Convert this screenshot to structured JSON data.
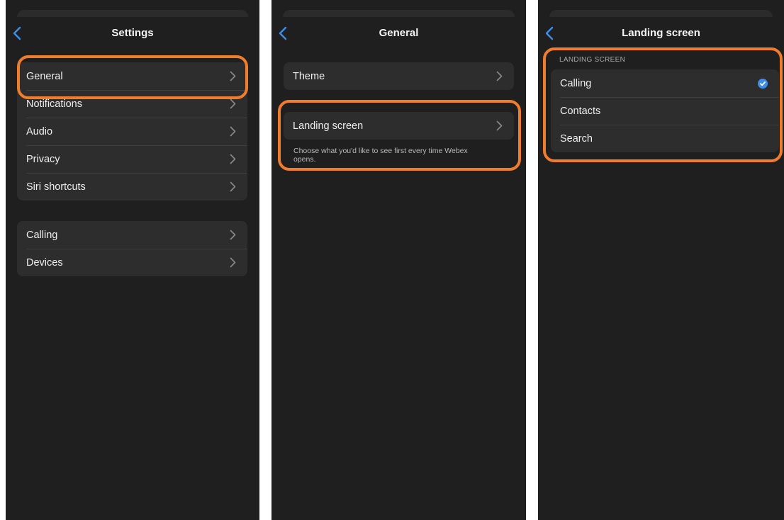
{
  "screens": [
    {
      "title": "Settings",
      "groups": [
        {
          "items": [
            "General",
            "Notifications",
            "Audio",
            "Privacy",
            "Siri shortcuts"
          ]
        },
        {
          "items": [
            "Calling",
            "Devices"
          ]
        }
      ]
    },
    {
      "title": "General",
      "theme_label": "Theme",
      "landing_label": "Landing screen",
      "landing_note": "Choose what you'd like to see first every time Webex opens."
    },
    {
      "title": "Landing screen",
      "section_header": "LANDING SCREEN",
      "options": [
        "Calling",
        "Contacts",
        "Search"
      ],
      "selected": "Calling"
    }
  ],
  "colors": {
    "highlight": "#ef7d2d",
    "accent": "#3d8eea",
    "background": "#1f1f1f",
    "cell": "#2d2d2d"
  },
  "icons": [
    "back-chevron-icon",
    "chevron-right-icon",
    "checkmark-icon"
  ]
}
